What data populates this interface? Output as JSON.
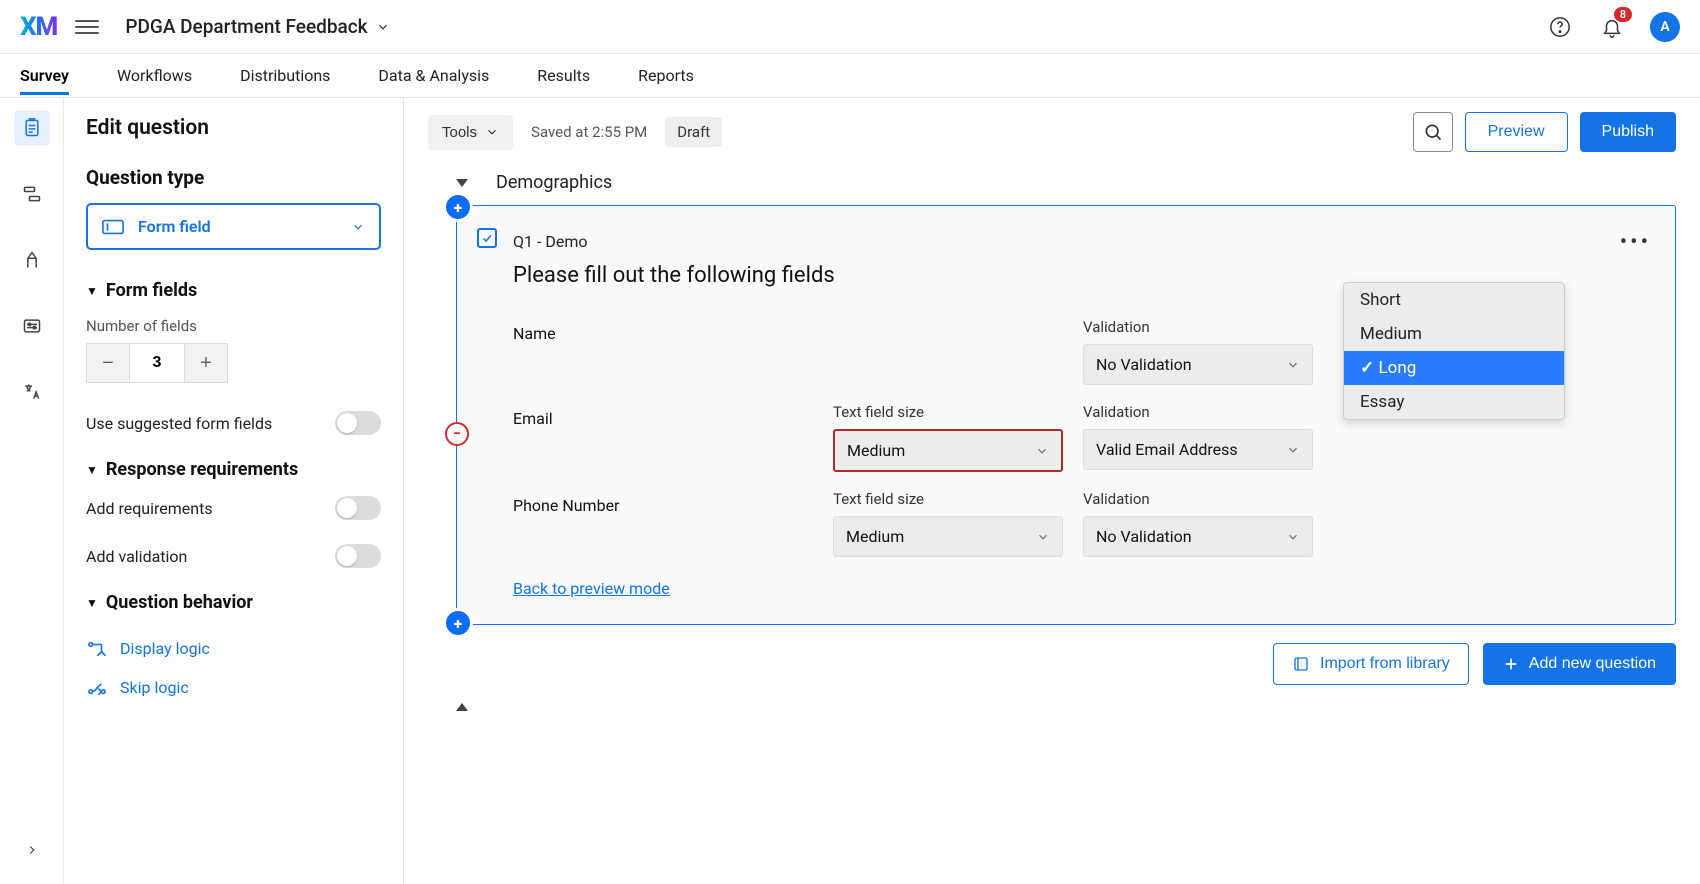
{
  "header": {
    "logo": "XM",
    "project_title": "PDGA Department Feedback",
    "notification_count": "8",
    "avatar_initial": "A"
  },
  "tabs": [
    {
      "label": "Survey",
      "active": true
    },
    {
      "label": "Workflows"
    },
    {
      "label": "Distributions"
    },
    {
      "label": "Data & Analysis"
    },
    {
      "label": "Results"
    },
    {
      "label": "Reports"
    }
  ],
  "edit_panel": {
    "title": "Edit question",
    "question_type_heading": "Question type",
    "question_type_value": "Form field",
    "form_fields_heading": "Form fields",
    "number_of_fields_label": "Number of fields",
    "number_of_fields_value": "3",
    "use_suggested_label": "Use suggested form fields",
    "response_req_heading": "Response requirements",
    "add_requirements_label": "Add requirements",
    "add_validation_label": "Add validation",
    "question_behavior_heading": "Question behavior",
    "display_logic_label": "Display logic",
    "skip_logic_label": "Skip logic"
  },
  "canvas_toolbar": {
    "tools_label": "Tools",
    "saved_text": "Saved at 2:55 PM",
    "draft_label": "Draft",
    "preview_label": "Preview",
    "publish_label": "Publish"
  },
  "block": {
    "name": "Demographics"
  },
  "question": {
    "id_label": "Q1 - Demo",
    "text": "Please fill out the following fields",
    "size_col_label": "Text field size",
    "validation_col_label": "Validation",
    "fields": [
      {
        "name": "Name",
        "size": "",
        "validation": "No Validation"
      },
      {
        "name": "Email",
        "size": "Medium",
        "validation": "Valid Email Address"
      },
      {
        "name": "Phone Number",
        "size": "Medium",
        "validation": "No Validation"
      }
    ],
    "back_link": "Back to preview mode"
  },
  "size_dropdown": {
    "options": [
      "Short",
      "Medium",
      "Long",
      "Essay"
    ],
    "selected": "Long"
  },
  "bottom": {
    "import_label": "Import from library",
    "add_label": "Add new question"
  }
}
